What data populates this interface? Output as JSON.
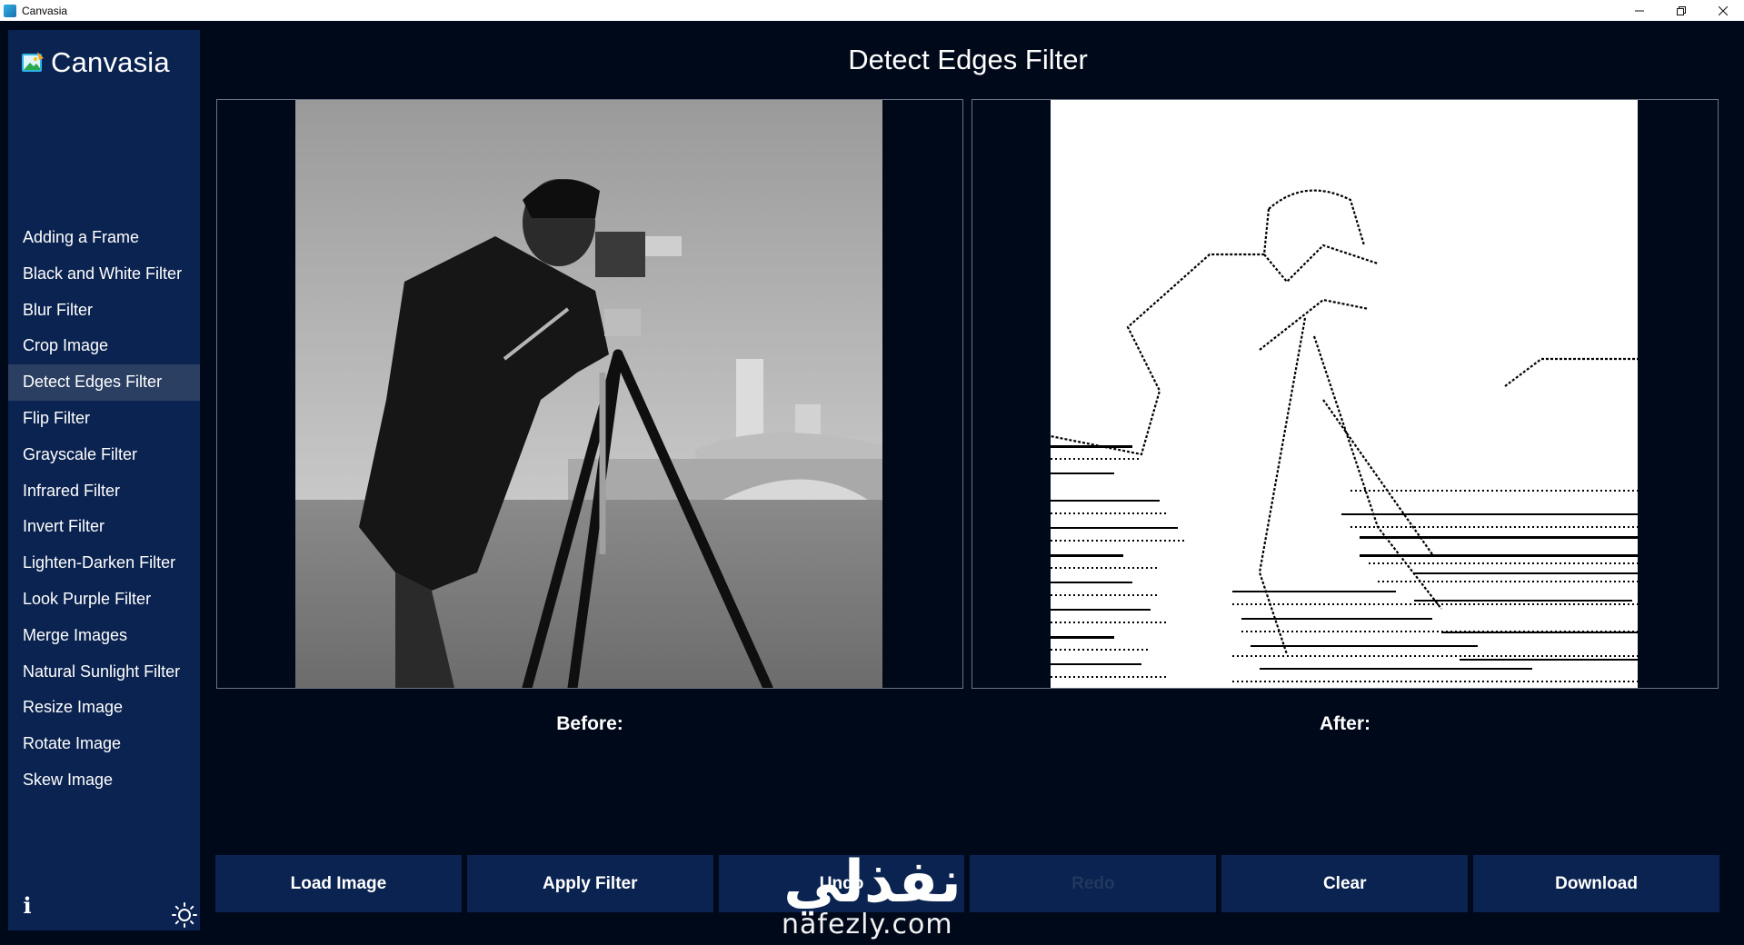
{
  "window": {
    "title": "Canvasia",
    "controls": [
      "minimize",
      "restore",
      "close"
    ]
  },
  "sidebar": {
    "brand": "Canvasia",
    "items": [
      {
        "label": "Adding a Frame",
        "active": false
      },
      {
        "label": "Black and White Filter",
        "active": false
      },
      {
        "label": "Blur Filter",
        "active": false
      },
      {
        "label": "Crop Image",
        "active": false
      },
      {
        "label": "Detect Edges Filter",
        "active": true
      },
      {
        "label": "Flip Filter",
        "active": false
      },
      {
        "label": "Grayscale Filter",
        "active": false
      },
      {
        "label": "Infrared Filter",
        "active": false
      },
      {
        "label": "Invert Filter",
        "active": false
      },
      {
        "label": "Lighten-Darken Filter",
        "active": false
      },
      {
        "label": "Look Purple Filter",
        "active": false
      },
      {
        "label": "Merge Images",
        "active": false
      },
      {
        "label": "Natural Sunlight Filter",
        "active": false
      },
      {
        "label": "Resize Image",
        "active": false
      },
      {
        "label": "Rotate Image",
        "active": false
      },
      {
        "label": "Skew Image",
        "active": false
      }
    ],
    "info_icon": "info-icon",
    "theme_icon": "sun-icon"
  },
  "main": {
    "title": "Detect Edges Filter",
    "before_label": "Before:",
    "after_label": "After:",
    "before_image": "cameraman photograph (grayscale)",
    "after_image": "edge-detected cameraman (black lines on white)"
  },
  "buttons": {
    "load": "Load Image",
    "apply": "Apply Filter",
    "undo": "Undo",
    "redo": "Redo",
    "clear": "Clear",
    "download": "Download"
  },
  "watermark": {
    "arabic": "نفذلي",
    "latin": "nafezly.com"
  },
  "colors": {
    "background": "#00091a",
    "sidebar": "#0b2350",
    "active_item": "#2b3f63",
    "button": "#0b2350",
    "disabled_text": "#22385e"
  }
}
